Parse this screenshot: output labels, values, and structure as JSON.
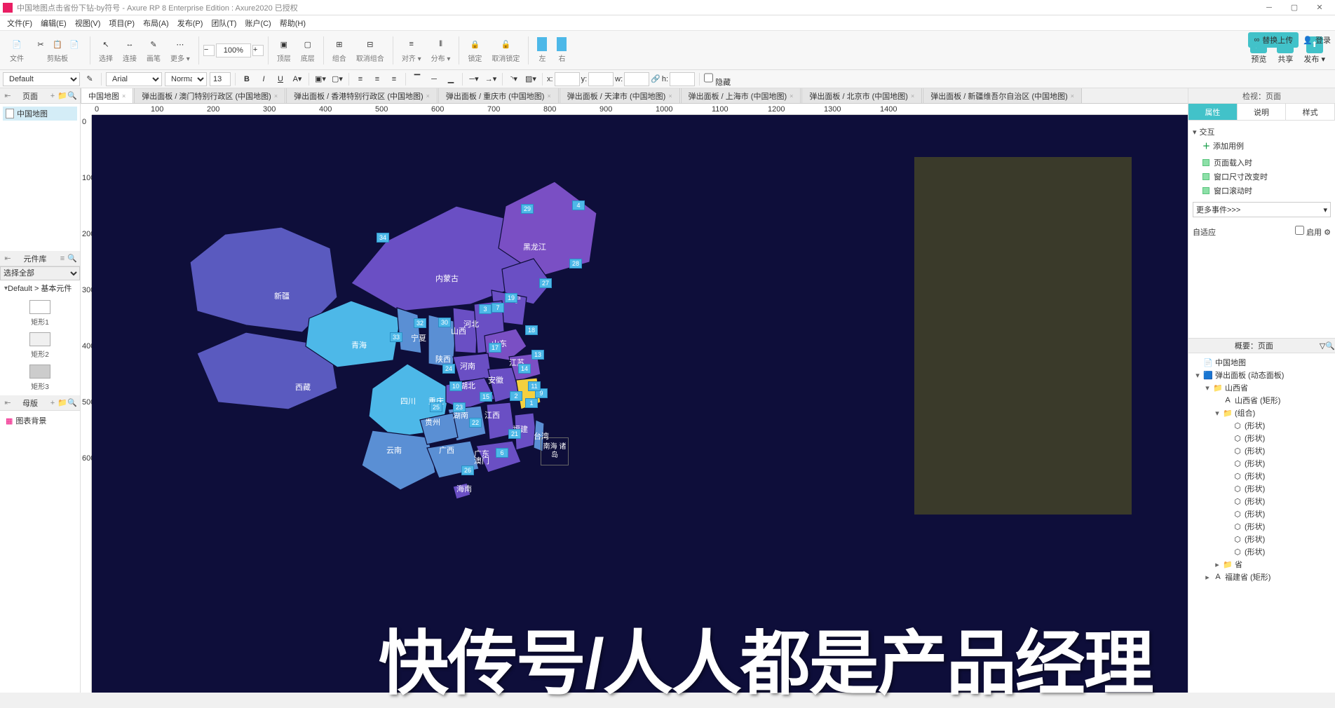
{
  "title": "中国地图点击省份下钻-by符号 - Axure RP 8 Enterprise Edition : Axure2020 已授权",
  "menu": [
    "文件(F)",
    "编辑(E)",
    "视图(V)",
    "项目(P)",
    "布局(A)",
    "发布(P)",
    "团队(T)",
    "账户(C)",
    "帮助(H)"
  ],
  "topright": {
    "replace": "替换上传",
    "login": "登录"
  },
  "toolbar": {
    "groups": [
      {
        "labels": [
          "文件"
        ],
        "sub": [
          "剪贴",
          "复制",
          "粘贴"
        ]
      },
      {
        "labels": [
          "剪贴板"
        ]
      },
      {
        "labels": [
          "选择",
          "连接",
          "画笔",
          "更多 ▾"
        ]
      },
      {
        "labels": [
          "顶层",
          "底层"
        ]
      },
      {
        "labels": [
          "组合",
          "取消组合"
        ]
      },
      {
        "labels": [
          "对齐 ▾",
          "分布 ▾"
        ]
      },
      {
        "labels": [
          "锁定",
          "取消锁定"
        ]
      },
      {
        "labels": [
          "左",
          "右"
        ]
      }
    ],
    "zoom": "100%",
    "publish": [
      "预览",
      "共享",
      "发布 ▾"
    ]
  },
  "format": {
    "style": "Default",
    "font": "Arial",
    "weight": "Normal",
    "size": "13",
    "coords": {
      "x": "x:",
      "y": "y:",
      "w": "w:",
      "h": "h:"
    },
    "hidden": "隐藏"
  },
  "left": {
    "pages_hdr": "页面",
    "page": "中国地图",
    "lib_hdr": "元件库",
    "lib_sel": "选择全部",
    "lib_crumb": "Default > 基本元件",
    "widgets": [
      "矩形1",
      "矩形2",
      "矩形3"
    ],
    "master_hdr": "母版",
    "master": "图表背景"
  },
  "tabs": [
    {
      "t": "中国地图",
      "a": true
    },
    {
      "t": "弹出面板 / 澳门特别行政区 (中国地图)"
    },
    {
      "t": "弹出面板 / 香港特别行政区 (中国地图)"
    },
    {
      "t": "弹出面板 / 重庆市 (中国地图)"
    },
    {
      "t": "弹出面板 / 天津市 (中国地图)"
    },
    {
      "t": "弹出面板 / 上海市 (中国地图)"
    },
    {
      "t": "弹出面板 / 北京市 (中国地图)"
    },
    {
      "t": "弹出面板 / 新疆维吾尔自治区 (中国地图)"
    }
  ],
  "ruler_h": [
    "0",
    "100",
    "200",
    "300",
    "400",
    "500",
    "600",
    "700",
    "800",
    "900",
    "1000",
    "1100",
    "1200",
    "1300",
    "1400"
  ],
  "ruler_v": [
    "0",
    "100",
    "200",
    "300",
    "400",
    "500",
    "600"
  ],
  "map": {
    "provinces": [
      "新疆",
      "西藏",
      "青海",
      "内蒙古",
      "黑龙江",
      "辽宁",
      "河北",
      "山西",
      "河南",
      "山东",
      "湖北",
      "安徽",
      "江苏",
      "四川",
      "重庆",
      "贵州",
      "湖南",
      "江西",
      "福建",
      "台湾",
      "云南",
      "广西",
      "广东",
      "海南",
      "南海\n诸岛",
      "宁夏",
      "陕西",
      "澳门"
    ],
    "nums": [
      "1",
      "2",
      "3",
      "4",
      "6",
      "7",
      "9",
      "10",
      "11",
      "13",
      "14",
      "15",
      "17",
      "18",
      "19",
      "21",
      "22",
      "23",
      "24",
      "25",
      "26",
      "27",
      "28",
      "29",
      "30",
      "32",
      "33",
      "34"
    ]
  },
  "right": {
    "insp_hdr": "检视：页面",
    "tabs": [
      "属性",
      "说明",
      "样式"
    ],
    "interact": "交互",
    "add_case": "添加用例",
    "events": [
      "页面载入时",
      "窗口尺寸改变时",
      "窗口滚动时"
    ],
    "more": "更多事件>>>",
    "adaptive": "自适应",
    "enable": "启用",
    "outline_hdr": "概要：页面",
    "outline": [
      {
        "i": 0,
        "e": "",
        "ic": "📄",
        "t": "中国地图"
      },
      {
        "i": 0,
        "e": "▾",
        "ic": "🟦",
        "t": "弹出面板 (动态面板)"
      },
      {
        "i": 1,
        "e": "▾",
        "ic": "📁",
        "t": "山西省"
      },
      {
        "i": 2,
        "e": "",
        "ic": "A",
        "t": "山西省 (矩形)"
      },
      {
        "i": 2,
        "e": "▾",
        "ic": "📁",
        "t": "(组合)"
      },
      {
        "i": 3,
        "e": "",
        "ic": "⬡",
        "t": "(形状)"
      },
      {
        "i": 3,
        "e": "",
        "ic": "⬡",
        "t": "(形状)"
      },
      {
        "i": 3,
        "e": "",
        "ic": "⬡",
        "t": "(形状)"
      },
      {
        "i": 3,
        "e": "",
        "ic": "⬡",
        "t": "(形状)"
      },
      {
        "i": 3,
        "e": "",
        "ic": "⬡",
        "t": "(形状)"
      },
      {
        "i": 3,
        "e": "",
        "ic": "⬡",
        "t": "(形状)"
      },
      {
        "i": 3,
        "e": "",
        "ic": "⬡",
        "t": "(形状)"
      },
      {
        "i": 3,
        "e": "",
        "ic": "⬡",
        "t": "(形状)"
      },
      {
        "i": 3,
        "e": "",
        "ic": "⬡",
        "t": "(形状)"
      },
      {
        "i": 3,
        "e": "",
        "ic": "⬡",
        "t": "(形状)"
      },
      {
        "i": 3,
        "e": "",
        "ic": "⬡",
        "t": "(形状)"
      },
      {
        "i": 2,
        "e": "▸",
        "ic": "📁",
        "t": "省"
      },
      {
        "i": 1,
        "e": "▸",
        "ic": "A",
        "t": "福建省 (矩形)"
      }
    ]
  },
  "watermark": "快传号/人人都是产品经理"
}
